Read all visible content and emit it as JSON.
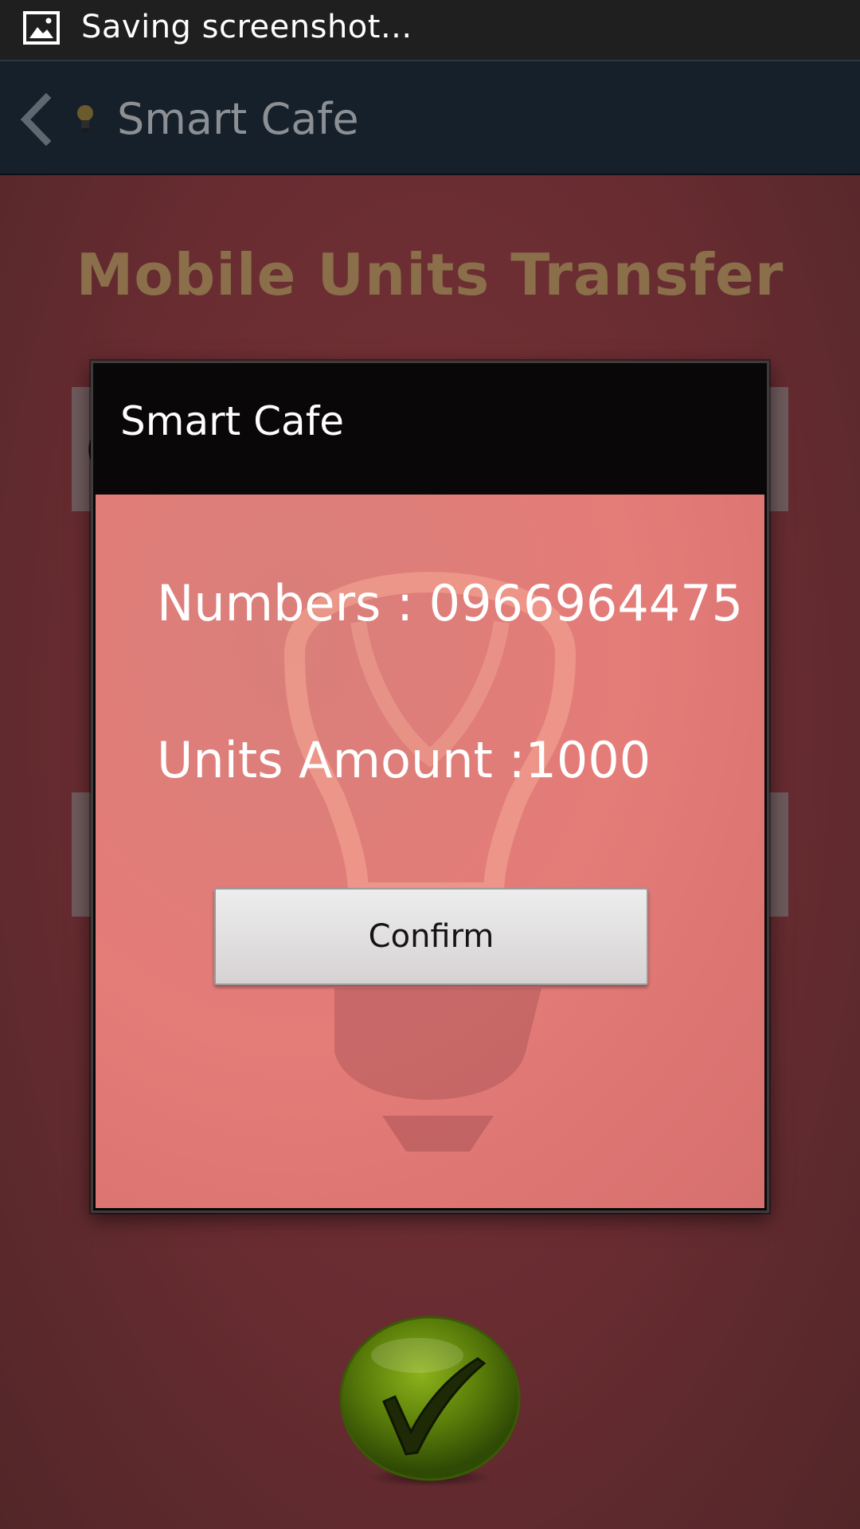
{
  "status_bar": {
    "icon": "image-icon",
    "text": "Saving screenshot..."
  },
  "action_bar": {
    "back_icon": "chevron-left-icon",
    "logo_icon": "lightbulb-logo-icon",
    "title": "Smart Cafe"
  },
  "screen": {
    "heading": "Mobile Units Transfer",
    "phone_field_value": "0966964475",
    "amount_field_value": "",
    "submit_icon": "check-icon"
  },
  "dialog": {
    "title": "Smart Cafe",
    "numbers_line": "Numbers : 0966964475",
    "amount_line": "Units Amount :1000",
    "confirm_label": "Confirm"
  },
  "colors": {
    "status_bar_bg": "#1f1f1f",
    "action_bar_bg": "#15202a",
    "screen_bg": "#7a3a3d",
    "dialog_body_bg": "#e47c78",
    "heading_color": "#8a6f4a",
    "check_button_green": "#5a7d0a"
  }
}
